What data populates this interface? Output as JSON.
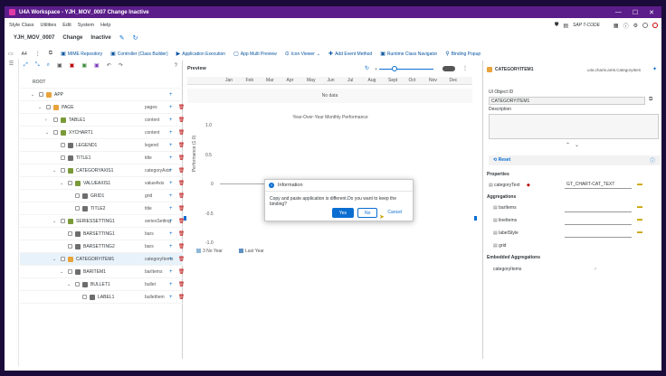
{
  "window": {
    "title": "U4A Workspace - YJH_MOV_0007 Change Inactive"
  },
  "menu": {
    "items": [
      "Style Class",
      "Utilities",
      "Edit",
      "System",
      "Help"
    ],
    "tcode": "SAP T-CODE"
  },
  "header": {
    "app_id": "YJH_MOV_0007",
    "mode": "Change",
    "status": "Inactive"
  },
  "toolbar": {
    "items": [
      "MIME Repository",
      "Controller (Class Builder)",
      "Application Execution",
      "App Multi Preview",
      "Icon Viewer",
      "Add Event Method",
      "Runtime Class Navigator",
      "Binding Popup"
    ],
    "left_label": "A4"
  },
  "tree": {
    "rows": [
      {
        "name": "ROOT",
        "agg": "",
        "indent": 0,
        "chev": "",
        "plus": false,
        "icon": ""
      },
      {
        "name": "APP",
        "agg": "",
        "indent": 1,
        "chev": "⌄",
        "plus": true,
        "icon": "#e8a33a"
      },
      {
        "name": "PAGE",
        "agg": "pages",
        "indent": 2,
        "chev": "⌄",
        "plus": true,
        "icon": "#e8a33a"
      },
      {
        "name": "TABLE1",
        "agg": "content",
        "indent": 3,
        "chev": "›",
        "plus": true,
        "icon": "#7a9a3a"
      },
      {
        "name": "XYCHART1",
        "agg": "content",
        "indent": 3,
        "chev": "⌄",
        "plus": true,
        "icon": "#7a9a3a"
      },
      {
        "name": "LEGEND1",
        "agg": "legend",
        "indent": 4,
        "chev": "",
        "plus": true,
        "icon": "#6d6d6d"
      },
      {
        "name": "TITLE1",
        "agg": "title",
        "indent": 4,
        "chev": "",
        "plus": true,
        "icon": "#6d6d6d"
      },
      {
        "name": "CATEGORYAXIS1",
        "agg": "categoryAxis",
        "indent": 4,
        "chev": "⌄",
        "plus": true,
        "icon": "#7a9a3a"
      },
      {
        "name": "VALUEAXIS1",
        "agg": "valueAxis",
        "indent": 5,
        "chev": "⌄",
        "plus": true,
        "icon": "#7a9a3a"
      },
      {
        "name": "GRID1",
        "agg": "grid",
        "indent": 6,
        "chev": "",
        "plus": true,
        "icon": "#6d6d6d"
      },
      {
        "name": "TITLE2",
        "agg": "title",
        "indent": 6,
        "chev": "",
        "plus": true,
        "icon": "#6d6d6d"
      },
      {
        "name": "SERIESSETTING1",
        "agg": "seriesSetting",
        "indent": 4,
        "chev": "⌄",
        "plus": true,
        "icon": "#7a9a3a"
      },
      {
        "name": "BARSETTING1",
        "agg": "bars",
        "indent": 5,
        "chev": "",
        "plus": true,
        "icon": "#6d6d6d"
      },
      {
        "name": "BARSETTING2",
        "agg": "bars",
        "indent": 5,
        "chev": "",
        "plus": true,
        "icon": "#6d6d6d"
      },
      {
        "name": "CATEGORYITEM1",
        "agg": "categoryItems",
        "indent": 4,
        "chev": "⌄",
        "plus": true,
        "icon": "#e8a33a",
        "sel": true
      },
      {
        "name": "BARITEM1",
        "agg": "barItems",
        "indent": 5,
        "chev": "⌄",
        "plus": true,
        "icon": "#6d6d6d"
      },
      {
        "name": "BULLET1",
        "agg": "bullet",
        "indent": 6,
        "chev": "⌄",
        "plus": true,
        "icon": "#6d6d6d"
      },
      {
        "name": "LABEL1",
        "agg": "bulletItem",
        "indent": 7,
        "chev": "",
        "plus": true,
        "icon": "#6d6d6d"
      }
    ]
  },
  "preview": {
    "title": "Preview",
    "months": [
      "Jan",
      "Feb",
      "Mar",
      "Apr",
      "May",
      "Jun",
      "Jul",
      "Aug",
      "Sept",
      "Oct",
      "Nov",
      "Dec"
    ],
    "no_data": "No data"
  },
  "chart_data": {
    "type": "bar",
    "title": "Year-Over-Year Monthly Performance",
    "ylabel": "Performance (1.0)",
    "yticks": [
      "1.0",
      "0.5",
      "0",
      "-0.5",
      "-1.0"
    ],
    "series": [
      {
        "name": "3 No Year",
        "values": []
      },
      {
        "name": "Last Year",
        "values": []
      }
    ]
  },
  "right": {
    "item_name": "CATEGORYITEM1",
    "class_path": "u4a.charts.am5.CategoryItem",
    "ui_object_id_label": "UI Object ID",
    "ui_object_id": "CATEGORYITEM1",
    "description_label": "Description",
    "reset_label": "Reset",
    "properties_label": "Properties",
    "prop_name": "categoryText",
    "prop_value": "GT_CHART-CAT_TEXT",
    "aggregations_label": "Aggregations",
    "agg_items": [
      "barItems",
      "lineItems",
      "labelStyle",
      "grid"
    ],
    "embedded_label": "Embedded Aggregations",
    "embedded_item": "categoryItems"
  },
  "dialog": {
    "title": "Information",
    "message": "Copy and paste application is different.Do you want to keep the binding?",
    "yes": "Yes",
    "no": "No",
    "cancel": "Cancel"
  }
}
